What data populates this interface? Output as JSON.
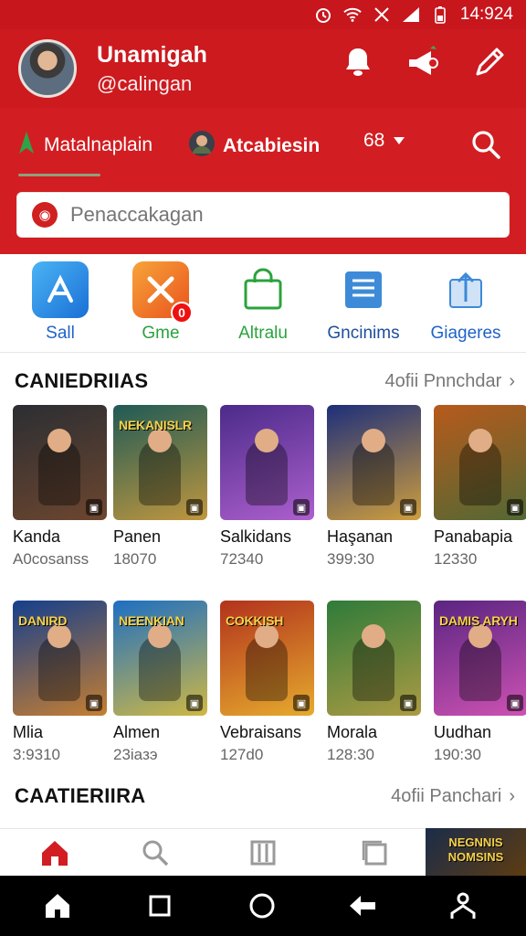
{
  "status_bar": {
    "time": "14:924"
  },
  "profile": {
    "name": "Unamigah",
    "handle": "@calingan"
  },
  "tabs": [
    {
      "label": "Matalnaplain",
      "icon": "green-arrow-icon"
    },
    {
      "label": "Atcabiesin",
      "icon": "avatar-icon"
    },
    {
      "label": "68",
      "icon": "chevron-down-icon"
    }
  ],
  "search": {
    "placeholder": "Penaccakagan"
  },
  "quick_actions": [
    {
      "label": "Sall",
      "color": "#1e63c8"
    },
    {
      "label": "Gme",
      "color": "#2aa33c",
      "badge": "0"
    },
    {
      "label": "Altralu",
      "color": "#2aa33c"
    },
    {
      "label": "Gncinims",
      "color": "#1d4f9c"
    },
    {
      "label": "Giageres",
      "color": "#1e63c8"
    }
  ],
  "sections": [
    {
      "title": "CANIEDRIIAS",
      "link": "4ofii Pnnchdar"
    },
    {
      "title": "CAATIERIIRA",
      "link": "4ofii Panchari"
    }
  ],
  "games_row1": [
    {
      "name": "Kanda",
      "count": "A0cosanss",
      "art_title": "",
      "bg": "#2b2e33",
      "accent": "#7a4b2e"
    },
    {
      "name": "Panen",
      "count": "18070",
      "art_title": "NEKANISLR",
      "bg": "#1f5a56",
      "accent": "#e0a33a"
    },
    {
      "name": "Salkidans",
      "count": "72340",
      "art_title": "",
      "bg": "#4b2b8a",
      "accent": "#c06adb"
    },
    {
      "name": "Haşanan",
      "count": "399:30",
      "art_title": "",
      "bg": "#1d2f7a",
      "accent": "#f2b431"
    },
    {
      "name": "Panabapia",
      "count": "12330",
      "art_title": "",
      "bg": "#b75a1b",
      "accent": "#3f6b3a"
    }
  ],
  "games_row2": [
    {
      "name": "Mlia",
      "count": "3:9310",
      "art_title": "DANIRD",
      "bg": "#153f8c",
      "accent": "#e98b20"
    },
    {
      "name": "Almen",
      "count": "23iaзэ",
      "art_title": "NEENKIAN",
      "bg": "#1d6fc3",
      "accent": "#f2c62b"
    },
    {
      "name": "Vebraisans",
      "count": "127d0",
      "art_title": "COKKISH",
      "bg": "#b2321d",
      "accent": "#f0c331"
    },
    {
      "name": "Morala",
      "count": "128:30",
      "art_title": "",
      "bg": "#2f7b3a",
      "accent": "#c4a145"
    },
    {
      "name": "Uudhan",
      "count": "190:30",
      "art_title": "DAMIS ARYH",
      "bg": "#5a2581",
      "accent": "#e45bbd"
    }
  ],
  "promo": {
    "text": "NEGNNIS NOMSINS"
  }
}
